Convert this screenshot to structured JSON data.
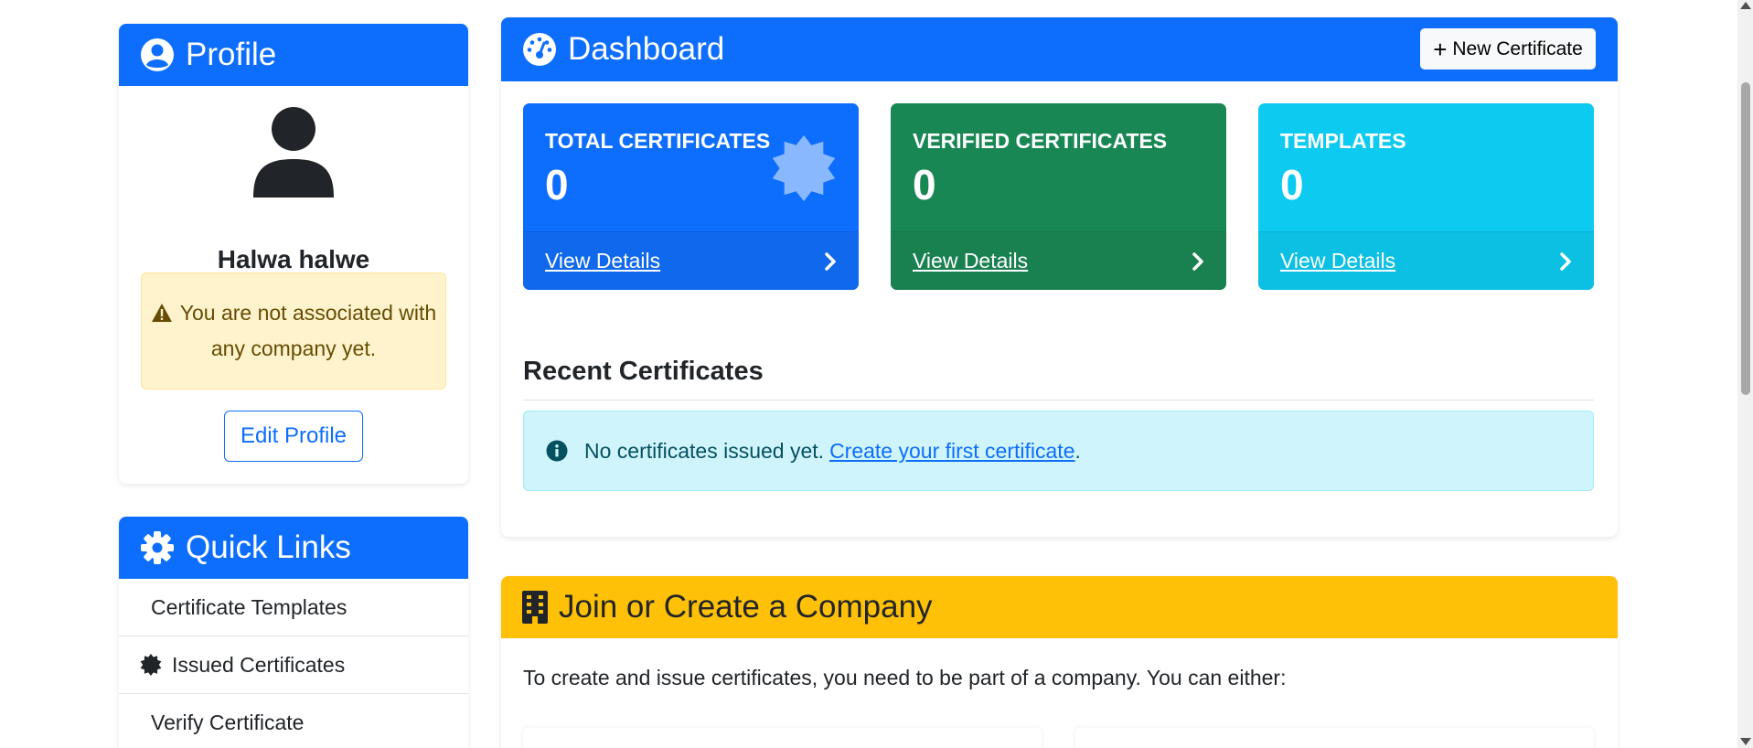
{
  "profile": {
    "title": "Profile",
    "user_name": "Halwa halwe",
    "warning": "You are not associated with any company yet.",
    "edit_label": "Edit Profile"
  },
  "quick_links": {
    "title": "Quick Links",
    "items": [
      {
        "label": "Certificate Templates"
      },
      {
        "label": "Issued Certificates"
      },
      {
        "label": "Verify Certificate"
      }
    ]
  },
  "dashboard": {
    "title": "Dashboard",
    "new_button": "New Certificate",
    "stats": [
      {
        "label": "TOTAL CERTIFICATES",
        "value": "0",
        "link": "View Details",
        "color": "#0d6efd"
      },
      {
        "label": "VERIFIED CERTIFICATES",
        "value": "0",
        "link": "View Details",
        "color": "#198754"
      },
      {
        "label": "TEMPLATES",
        "value": "0",
        "link": "View Details",
        "color": "#0dcaf0"
      }
    ],
    "recent_title": "Recent Certificates",
    "info_text": "No certificates issued yet.",
    "info_link": "Create your first certificate",
    "info_suffix": "."
  },
  "company": {
    "title": "Join or Create a Company",
    "text": "To create and issue certificates, you need to be part of a company. You can either:",
    "accent_color": "#ffc107"
  },
  "icons": {
    "profile": "user-circle-icon",
    "quick_links": "gear-icon",
    "dashboard": "gauge-icon",
    "company": "building-icon",
    "warning": "warning-triangle-icon",
    "info": "info-circle-icon",
    "certificate": "certificate-badge-icon",
    "chevron": "chevron-right-icon",
    "plus": "plus-icon"
  }
}
